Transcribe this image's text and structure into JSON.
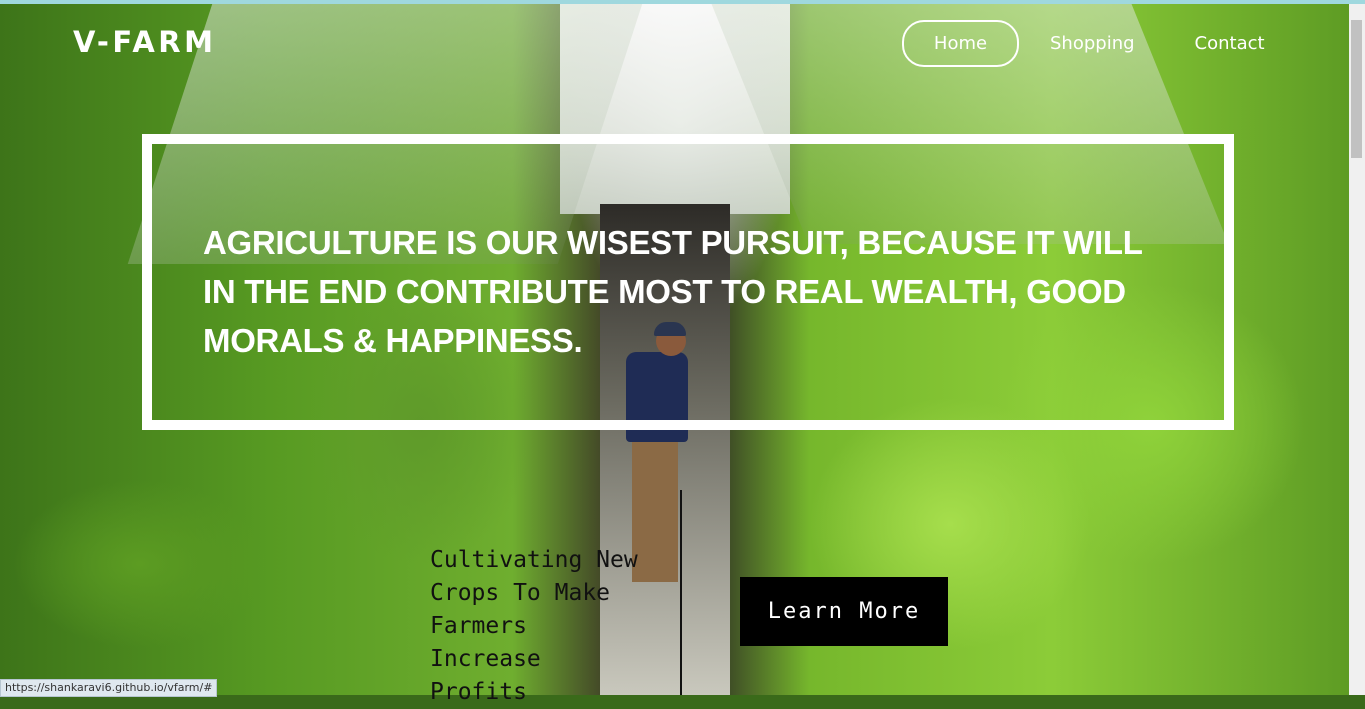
{
  "brand": {
    "logo": "V-FARM"
  },
  "nav": {
    "home": "Home",
    "shopping": "Shopping",
    "contact": "Contact"
  },
  "hero": {
    "quote": "AGRICULTURE IS OUR WISEST PURSUIT, BECAUSE IT WILL IN THE END CONTRIBUTE MOST TO REAL WEALTH, GOOD MORALS & HAPPINESS."
  },
  "promo": {
    "tagline": "Cultivating New Crops To Make Farmers Increase Profits",
    "button": "Learn More"
  },
  "status_bar": {
    "url": "https://shankaravi6.github.io/vfarm/#"
  }
}
